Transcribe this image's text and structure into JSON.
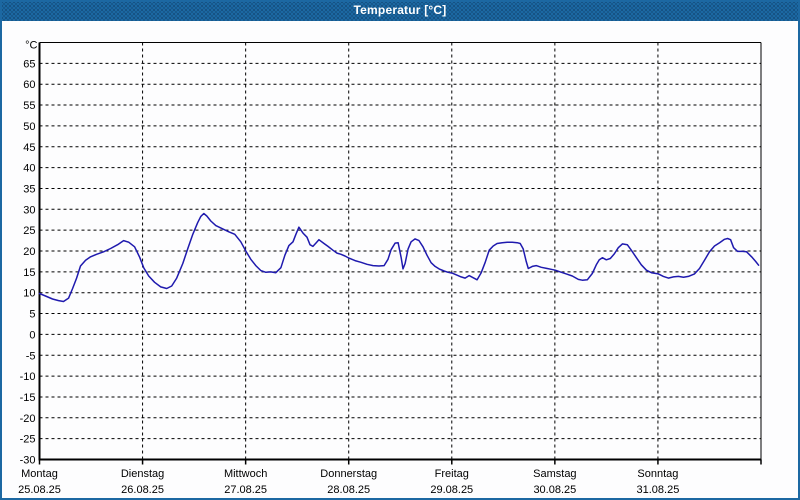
{
  "window": {
    "title": "Temperatur [°C]"
  },
  "colors": {
    "titlebar": "#1c68a2",
    "frame_border": "#1c68a2",
    "title_text": "#ffffff",
    "plot_border": "#000000",
    "grid": "#000000",
    "line": "#1f1aae",
    "background": "#fdfdfe",
    "label_text": "#000000"
  },
  "chart_data": {
    "type": "line",
    "title": "Temperatur [°C]",
    "y_unit_label": "°C",
    "ylim": [
      -30,
      70
    ],
    "y_ticks": [
      65,
      60,
      55,
      50,
      45,
      40,
      35,
      30,
      25,
      20,
      15,
      10,
      5,
      0,
      -5,
      -10,
      -15,
      -20,
      -25,
      -30
    ],
    "grid": "dashed",
    "legend_position": "none",
    "x_range_days": [
      0,
      7
    ],
    "x_axis_days": [
      {
        "day": "Montag",
        "date": "25.08.25"
      },
      {
        "day": "Dienstag",
        "date": "26.08.25"
      },
      {
        "day": "Mittwoch",
        "date": "27.08.25"
      },
      {
        "day": "Donnerstag",
        "date": "28.08.25"
      },
      {
        "day": "Freitag",
        "date": "29.08.25"
      },
      {
        "day": "Samstag",
        "date": "30.08.25"
      },
      {
        "day": "Sonntag",
        "date": "31.08.25"
      }
    ],
    "series": [
      {
        "name": "Temperatur",
        "points": [
          [
            0.0,
            9.8
          ],
          [
            0.058,
            9.2
          ],
          [
            0.126,
            8.5
          ],
          [
            0.185,
            8.1
          ],
          [
            0.233,
            7.9
          ],
          [
            0.282,
            8.7
          ],
          [
            0.321,
            11.0
          ],
          [
            0.36,
            13.5
          ],
          [
            0.398,
            16.4
          ],
          [
            0.447,
            17.8
          ],
          [
            0.496,
            18.6
          ],
          [
            0.554,
            19.2
          ],
          [
            0.622,
            19.8
          ],
          [
            0.69,
            20.6
          ],
          [
            0.758,
            21.5
          ],
          [
            0.816,
            22.5
          ],
          [
            0.865,
            22.1
          ],
          [
            0.923,
            21.0
          ],
          [
            0.972,
            18.5
          ],
          [
            1.011,
            16.0
          ],
          [
            1.059,
            14.0
          ],
          [
            1.117,
            12.5
          ],
          [
            1.176,
            11.4
          ],
          [
            1.234,
            11.0
          ],
          [
            1.283,
            11.6
          ],
          [
            1.331,
            13.5
          ],
          [
            1.39,
            17.0
          ],
          [
            1.438,
            20.5
          ],
          [
            1.487,
            24.0
          ],
          [
            1.535,
            26.8
          ],
          [
            1.565,
            28.3
          ],
          [
            1.594,
            29.0
          ],
          [
            1.623,
            28.4
          ],
          [
            1.662,
            27.2
          ],
          [
            1.71,
            26.1
          ],
          [
            1.778,
            25.3
          ],
          [
            1.837,
            24.6
          ],
          [
            1.895,
            24.0
          ],
          [
            1.953,
            22.2
          ],
          [
            2.002,
            20.0
          ],
          [
            2.05,
            18.0
          ],
          [
            2.099,
            16.5
          ],
          [
            2.148,
            15.3
          ],
          [
            2.196,
            14.9
          ],
          [
            2.245,
            15.0
          ],
          [
            2.293,
            14.8
          ],
          [
            2.342,
            16.0
          ],
          [
            2.381,
            19.0
          ],
          [
            2.42,
            21.3
          ],
          [
            2.459,
            22.2
          ],
          [
            2.488,
            24.0
          ],
          [
            2.517,
            25.7
          ],
          [
            2.556,
            24.3
          ],
          [
            2.595,
            23.3
          ],
          [
            2.624,
            21.5
          ],
          [
            2.653,
            21.1
          ],
          [
            2.682,
            21.9
          ],
          [
            2.711,
            22.7
          ],
          [
            2.76,
            21.8
          ],
          [
            2.799,
            21.1
          ],
          [
            2.847,
            20.2
          ],
          [
            2.886,
            19.5
          ],
          [
            2.925,
            19.2
          ],
          [
            2.964,
            18.8
          ],
          [
            3.002,
            18.3
          ],
          [
            3.061,
            17.7
          ],
          [
            3.119,
            17.3
          ],
          [
            3.177,
            16.8
          ],
          [
            3.236,
            16.5
          ],
          [
            3.294,
            16.4
          ],
          [
            3.343,
            16.5
          ],
          [
            3.381,
            18.0
          ],
          [
            3.411,
            20.3
          ],
          [
            3.45,
            21.9
          ],
          [
            3.479,
            22.0
          ],
          [
            3.508,
            18.5
          ],
          [
            3.527,
            15.7
          ],
          [
            3.547,
            17.0
          ],
          [
            3.576,
            20.5
          ],
          [
            3.605,
            22.2
          ],
          [
            3.644,
            22.9
          ],
          [
            3.682,
            22.5
          ],
          [
            3.721,
            21.0
          ],
          [
            3.76,
            19.0
          ],
          [
            3.799,
            17.2
          ],
          [
            3.838,
            16.3
          ],
          [
            3.877,
            15.7
          ],
          [
            3.925,
            15.2
          ],
          [
            3.964,
            14.9
          ],
          [
            4.003,
            14.7
          ],
          [
            4.052,
            14.2
          ],
          [
            4.09,
            13.8
          ],
          [
            4.129,
            13.5
          ],
          [
            4.168,
            14.1
          ],
          [
            4.207,
            13.6
          ],
          [
            4.246,
            13.1
          ],
          [
            4.285,
            14.8
          ],
          [
            4.324,
            17.3
          ],
          [
            4.363,
            20.2
          ],
          [
            4.402,
            21.2
          ],
          [
            4.44,
            21.8
          ],
          [
            4.489,
            22.0
          ],
          [
            4.538,
            22.1
          ],
          [
            4.586,
            22.1
          ],
          [
            4.635,
            22.0
          ],
          [
            4.664,
            21.8
          ],
          [
            4.693,
            20.5
          ],
          [
            4.722,
            17.5
          ],
          [
            4.742,
            15.8
          ],
          [
            4.781,
            16.3
          ],
          [
            4.819,
            16.5
          ],
          [
            4.868,
            16.1
          ],
          [
            4.926,
            15.8
          ],
          [
            4.965,
            15.6
          ],
          [
            5.004,
            15.4
          ],
          [
            5.053,
            15.0
          ],
          [
            5.111,
            14.5
          ],
          [
            5.169,
            14.0
          ],
          [
            5.227,
            13.2
          ],
          [
            5.266,
            13.0
          ],
          [
            5.315,
            13.1
          ],
          [
            5.363,
            14.6
          ],
          [
            5.402,
            16.7
          ],
          [
            5.431,
            17.9
          ],
          [
            5.461,
            18.4
          ],
          [
            5.499,
            17.9
          ],
          [
            5.538,
            18.2
          ],
          [
            5.577,
            19.3
          ],
          [
            5.616,
            20.8
          ],
          [
            5.655,
            21.7
          ],
          [
            5.703,
            21.5
          ],
          [
            5.742,
            20.2
          ],
          [
            5.791,
            18.4
          ],
          [
            5.839,
            16.7
          ],
          [
            5.888,
            15.4
          ],
          [
            5.937,
            14.8
          ],
          [
            6.005,
            14.5
          ],
          [
            6.053,
            13.9
          ],
          [
            6.102,
            13.5
          ],
          [
            6.15,
            13.8
          ],
          [
            6.199,
            13.9
          ],
          [
            6.248,
            13.7
          ],
          [
            6.296,
            13.9
          ],
          [
            6.355,
            14.5
          ],
          [
            6.403,
            15.8
          ],
          [
            6.452,
            17.8
          ],
          [
            6.5,
            19.8
          ],
          [
            6.549,
            21.2
          ],
          [
            6.598,
            22.0
          ],
          [
            6.646,
            22.8
          ],
          [
            6.676,
            23.0
          ],
          [
            6.705,
            22.7
          ],
          [
            6.734,
            20.8
          ],
          [
            6.773,
            19.9
          ],
          [
            6.821,
            19.9
          ],
          [
            6.86,
            19.8
          ],
          [
            6.909,
            18.6
          ],
          [
            6.948,
            17.5
          ],
          [
            6.977,
            16.6
          ]
        ]
      }
    ]
  }
}
